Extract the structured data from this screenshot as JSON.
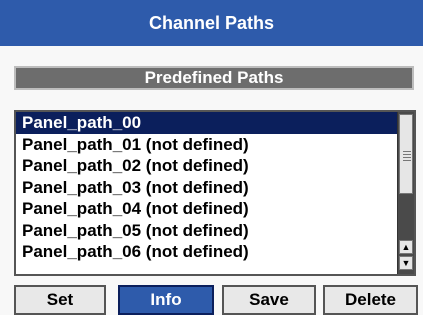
{
  "window": {
    "title": "Channel Paths"
  },
  "section": {
    "header": "Predefined Paths"
  },
  "list": {
    "items": [
      "Panel_path_00",
      "Panel_path_01 (not defined)",
      "Panel_path_02 (not defined)",
      "Panel_path_03 (not defined)",
      "Panel_path_04 (not defined)",
      "Panel_path_05 (not defined)",
      "Panel_path_06 (not defined)"
    ],
    "selected_index": 0
  },
  "scrollbar": {
    "up_icon": "triangle-up",
    "down_icon": "triangle-down"
  },
  "buttons": {
    "set": "Set",
    "info": "Info",
    "save": "Save",
    "delete": "Delete",
    "active": "info"
  },
  "colors": {
    "title_bg": "#2e5bab",
    "selection_bg": "#0b1f5c",
    "header_bg": "#6d6d6d"
  }
}
